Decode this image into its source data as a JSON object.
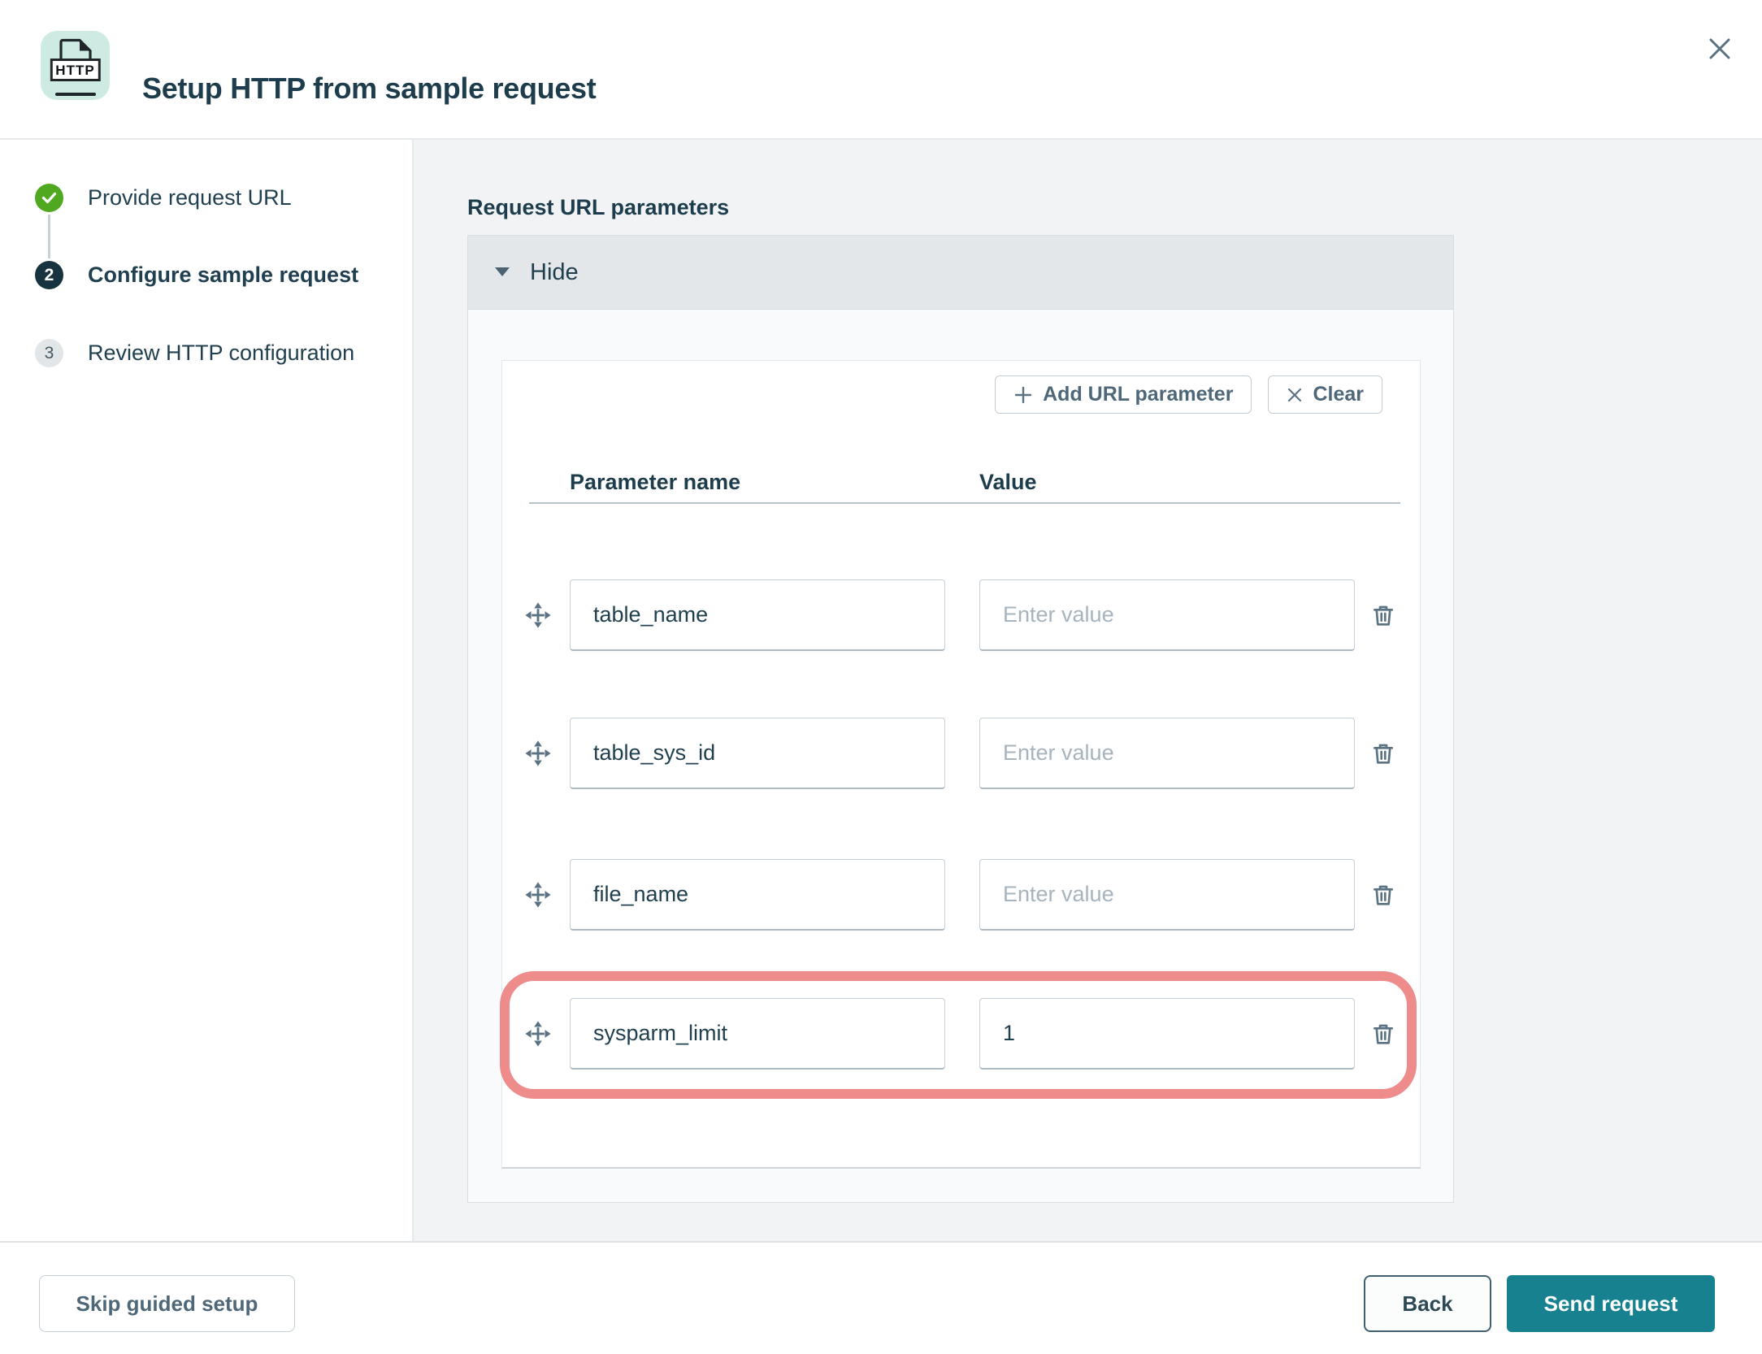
{
  "header": {
    "title": "Setup HTTP from sample request",
    "icon_label": "HTTP"
  },
  "steps": [
    {
      "label": "Provide request URL",
      "state": "complete"
    },
    {
      "number": "2",
      "label": "Configure sample request",
      "state": "active"
    },
    {
      "number": "3",
      "label": "Review HTTP configuration",
      "state": "upcoming"
    }
  ],
  "main": {
    "section_title": "Request URL parameters",
    "collapse_label": "Hide",
    "toolbar": {
      "add_label": "Add URL parameter",
      "clear_label": "Clear"
    },
    "table": {
      "columns": {
        "name": "Parameter name",
        "value": "Value"
      },
      "value_placeholder": "Enter value",
      "rows": [
        {
          "name": "table_name",
          "value": "",
          "highlighted": false
        },
        {
          "name": "table_sys_id",
          "value": "",
          "highlighted": false
        },
        {
          "name": "file_name",
          "value": "",
          "highlighted": false
        },
        {
          "name": "sysparm_limit",
          "value": "1",
          "highlighted": true
        }
      ]
    }
  },
  "footer": {
    "skip_label": "Skip guided setup",
    "back_label": "Back",
    "send_label": "Send request"
  },
  "colors": {
    "accent_teal": "#17818f",
    "success_green": "#4fa81f",
    "active_step_navy": "#17333f",
    "highlight_red": "#ee8b8b",
    "icon_bg_mint": "#cdebe2"
  }
}
